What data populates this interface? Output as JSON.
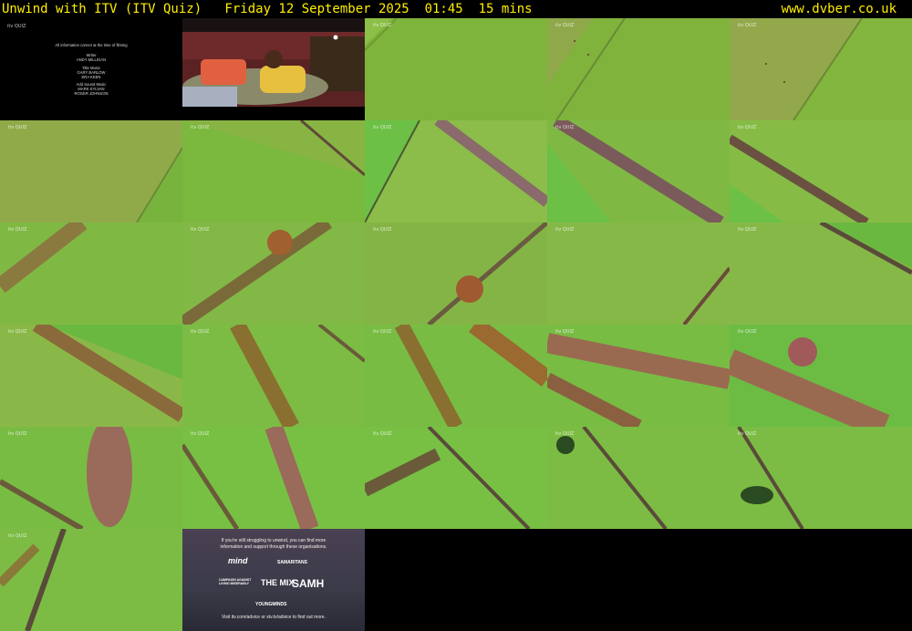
{
  "header": {
    "title": "Unwind with ITV (ITV Quiz)   Friday 12 September 2025  01:45  15 mins",
    "site": "www.dvber.co.uk"
  },
  "watermark": "itv QUIZ",
  "credits": {
    "intro": "All information correct at the time of filming",
    "writer_label": "Writer",
    "writer_name": "ANDY MILLIGAN",
    "music_label": "Title Music",
    "music_names": [
      "GARY BARLOW",
      "ERA KEEN"
    ],
    "sound_label": "Add Sound Music",
    "sound_names": [
      "MARK SYLVAN",
      "ROGER JOHNSON"
    ]
  },
  "advice": {
    "top_text": "If you're still struggling to unwind, you can find more information and support through these organisations.",
    "logos": [
      "mind",
      "SAMARITANS",
      "CAMPAIGN AGAINST LIVING MISERABLY",
      "THE MIX",
      "SAMH",
      "YOUNGMINDS"
    ],
    "bottom_text": "Visit itv.com/advice or stv.tv/advice to find out more."
  },
  "colors": {
    "header_text": "#ffee00",
    "background": "#000000",
    "field_green": "#7dbb3a",
    "hedge_brown": "#5a4a3a"
  }
}
